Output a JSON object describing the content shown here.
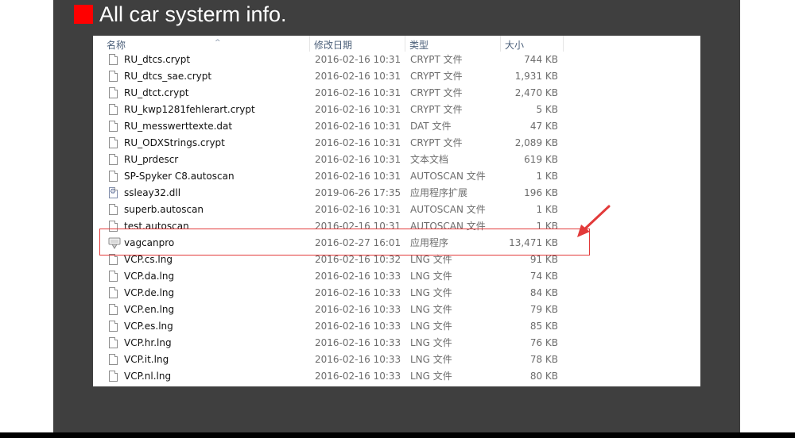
{
  "title": "All car systerm info.",
  "colors": {
    "accent": "#ff0000",
    "panel": "#3f3f3f",
    "annotation": "#e23a3a"
  },
  "explorer": {
    "columns": {
      "name": "名称",
      "date": "修改日期",
      "type": "类型",
      "size": "大小"
    },
    "rows": [
      {
        "name": "RU_dtcs.crypt",
        "date": "2016-02-16  10:31",
        "type": "CRYPT 文件",
        "size": "744 KB",
        "icon": "file-icon"
      },
      {
        "name": "RU_dtcs_sae.crypt",
        "date": "2016-02-16  10:31",
        "type": "CRYPT 文件",
        "size": "1,931 KB",
        "icon": "file-icon"
      },
      {
        "name": "RU_dtct.crypt",
        "date": "2016-02-16  10:31",
        "type": "CRYPT 文件",
        "size": "2,470 KB",
        "icon": "file-icon"
      },
      {
        "name": "RU_kwp1281fehlerart.crypt",
        "date": "2016-02-16  10:31",
        "type": "CRYPT 文件",
        "size": "5 KB",
        "icon": "file-icon"
      },
      {
        "name": "RU_messwerttexte.dat",
        "date": "2016-02-16  10:31",
        "type": "DAT 文件",
        "size": "47 KB",
        "icon": "file-icon"
      },
      {
        "name": "RU_ODXStrings.crypt",
        "date": "2016-02-16  10:31",
        "type": "CRYPT 文件",
        "size": "2,089 KB",
        "icon": "file-icon"
      },
      {
        "name": "RU_prdescr",
        "date": "2016-02-16  10:31",
        "type": "文本文档",
        "size": "619 KB",
        "icon": "file-icon"
      },
      {
        "name": "SP-Spyker C8.autoscan",
        "date": "2016-02-16  10:31",
        "type": "AUTOSCAN 文件",
        "size": "1 KB",
        "icon": "file-icon"
      },
      {
        "name": "ssleay32.dll",
        "date": "2019-06-26  17:35",
        "type": "应用程序扩展",
        "size": "196 KB",
        "icon": "dll-icon"
      },
      {
        "name": "superb.autoscan",
        "date": "2016-02-16  10:31",
        "type": "AUTOSCAN 文件",
        "size": "1 KB",
        "icon": "file-icon"
      },
      {
        "name": "test.autoscan",
        "date": "2016-02-16  10:31",
        "type": "AUTOSCAN 文件",
        "size": "1 KB",
        "icon": "file-icon"
      },
      {
        "name": "vagcanpro",
        "date": "2016-02-27  16:01",
        "type": "应用程序",
        "size": "13,471 KB",
        "icon": "exe-icon"
      },
      {
        "name": "VCP.cs.lng",
        "date": "2016-02-16  10:32",
        "type": "LNG 文件",
        "size": "91 KB",
        "icon": "file-icon"
      },
      {
        "name": "VCP.da.lng",
        "date": "2016-02-16  10:33",
        "type": "LNG 文件",
        "size": "74 KB",
        "icon": "file-icon"
      },
      {
        "name": "VCP.de.lng",
        "date": "2016-02-16  10:33",
        "type": "LNG 文件",
        "size": "84 KB",
        "icon": "file-icon"
      },
      {
        "name": "VCP.en.lng",
        "date": "2016-02-16  10:33",
        "type": "LNG 文件",
        "size": "79 KB",
        "icon": "file-icon"
      },
      {
        "name": "VCP.es.lng",
        "date": "2016-02-16  10:33",
        "type": "LNG 文件",
        "size": "85 KB",
        "icon": "file-icon"
      },
      {
        "name": "VCP.hr.lng",
        "date": "2016-02-16  10:33",
        "type": "LNG 文件",
        "size": "76 KB",
        "icon": "file-icon"
      },
      {
        "name": "VCP.it.lng",
        "date": "2016-02-16  10:33",
        "type": "LNG 文件",
        "size": "78 KB",
        "icon": "file-icon"
      },
      {
        "name": "VCP.nl.lng",
        "date": "2016-02-16  10:33",
        "type": "LNG 文件",
        "size": "80 KB",
        "icon": "file-icon"
      }
    ]
  }
}
